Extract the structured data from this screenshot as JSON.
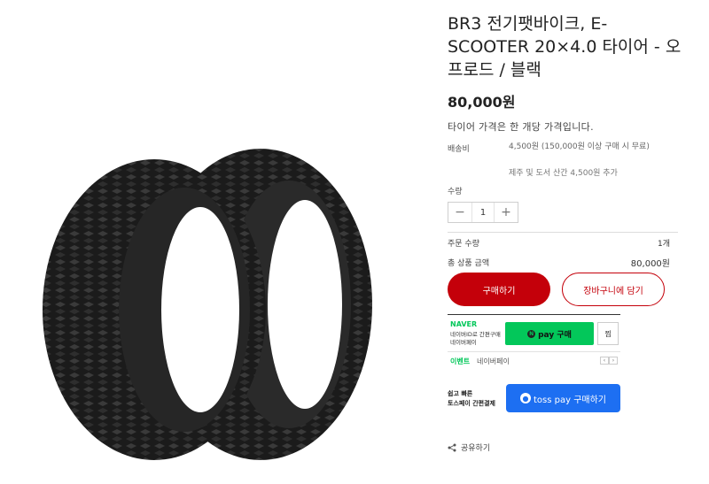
{
  "product": {
    "title": "BR3 전기팻바이크, E-SCOOTER 20×4.0 타이어 - 오프로드 / 블랙",
    "price": "80,000원",
    "description": "타이어 가격은 한 개당 가격입니다."
  },
  "shipping": {
    "label": "배송비",
    "text": "4,500원 (150,000원 이상 구매 시 무료)",
    "extra": "제주 및 도서 산간 4,500원 추가"
  },
  "quantity": {
    "label": "수량",
    "minus": "−",
    "value": "1",
    "plus": "+"
  },
  "summary": {
    "order_qty_label": "주문 수량",
    "order_qty_value": "1개",
    "total_label": "총 상품 금액",
    "total_value": "80,000원"
  },
  "actions": {
    "buy_label": "구매하기",
    "cart_label": "장바구니에 담기"
  },
  "naver": {
    "brand": "NAVER",
    "sub1": "네이버ID로 간편구매",
    "sub2": "네이버페이",
    "pay_badge": "N",
    "pay_label": "pay 구매",
    "zzim_label": "찜",
    "event_label": "이벤트",
    "event_text": "네이버페이",
    "prev": "‹",
    "next": "›"
  },
  "toss": {
    "line1": "쉽고 빠른",
    "line2": "토스페이 간편결제",
    "logo": "●",
    "button_label": "toss pay 구매하기"
  },
  "share": {
    "label": "공유하기",
    "icon": "share-icon"
  },
  "colors": {
    "buy": "#c4000a",
    "naver": "#03c75a",
    "toss": "#1d6ff2"
  }
}
